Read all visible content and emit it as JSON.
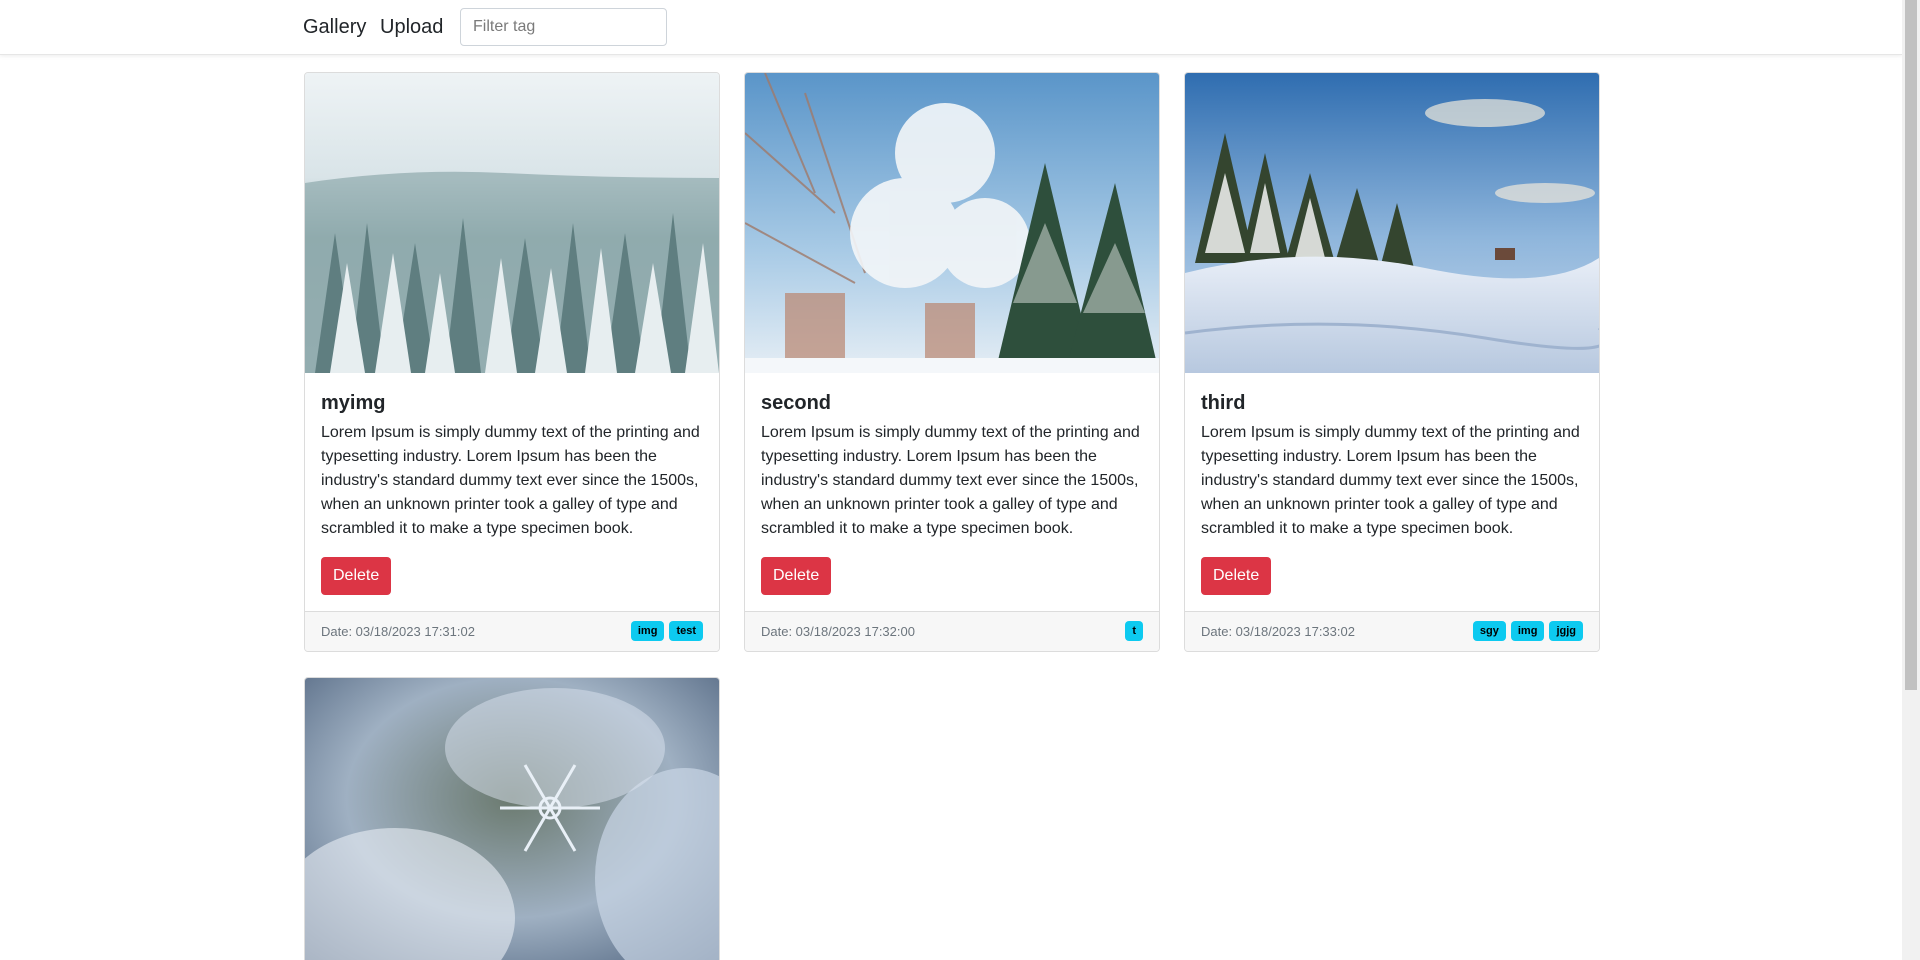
{
  "navbar": {
    "gallery_label": "Gallery",
    "upload_label": "Upload",
    "filter_placeholder": "Filter tag"
  },
  "cards": [
    {
      "title": "myimg",
      "text": "Lorem Ipsum is simply dummy text of the printing and typesetting industry. Lorem Ipsum has been the industry's standard dummy text ever since the 1500s, when an unknown printer took a galley of type and scrambled it to make a type specimen book.",
      "delete_label": "Delete",
      "date": "Date: 03/18/2023 17:31:02",
      "tags": [
        "img",
        "test"
      ],
      "image": "frosty forest aerial view"
    },
    {
      "title": "second",
      "text": "Lorem Ipsum is simply dummy text of the printing and typesetting industry. Lorem Ipsum has been the industry's standard dummy text ever since the 1500s, when an unknown printer took a galley of type and scrambled it to make a type specimen book.",
      "delete_label": "Delete",
      "date": "Date: 03/18/2023 17:32:00",
      "tags": [
        "t"
      ],
      "image": "snowy trees under blue sky"
    },
    {
      "title": "third",
      "text": "Lorem Ipsum is simply dummy text of the printing and typesetting industry. Lorem Ipsum has been the industry's standard dummy text ever since the 1500s, when an unknown printer took a galley of type and scrambled it to make a type specimen book.",
      "delete_label": "Delete",
      "date": "Date: 03/18/2023 17:33:02",
      "tags": [
        "sgy",
        "img",
        "jgjg"
      ],
      "image": "snow field with pines"
    },
    {
      "image": "snowflake macro"
    }
  ],
  "colors": {
    "danger": "#dc3545",
    "tag": "#0dcaf0",
    "footer_bg": "#f7f7f7"
  }
}
